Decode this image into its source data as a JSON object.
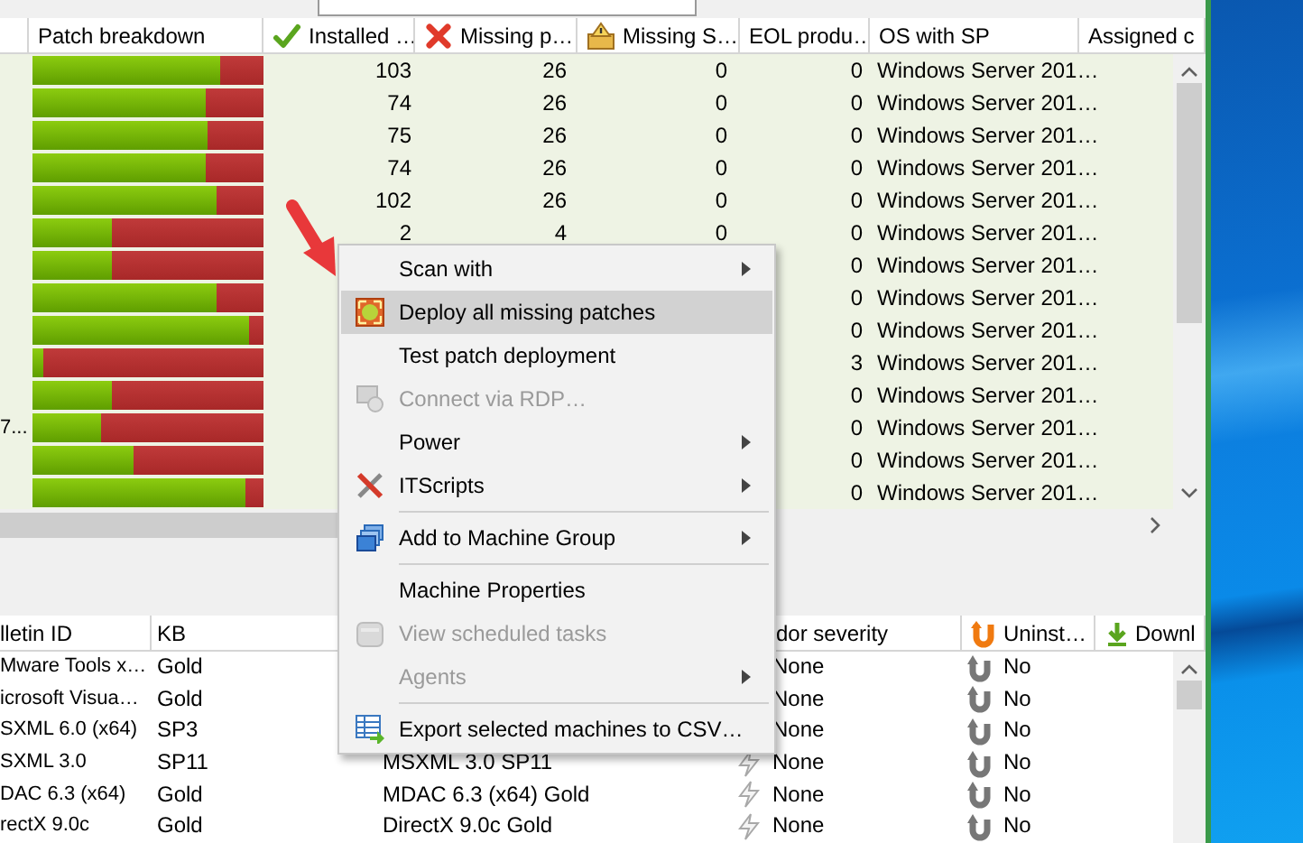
{
  "upper_table": {
    "columns": [
      {
        "label": "Patch breakdown",
        "kind": "bar"
      },
      {
        "label": "Installed …",
        "kind": "check"
      },
      {
        "label": "Missing p…",
        "kind": "cross"
      },
      {
        "label": "Missing S…",
        "kind": "warning"
      },
      {
        "label": "EOL produ…",
        "kind": "number"
      },
      {
        "label": "OS with SP",
        "kind": "text"
      },
      {
        "label": "Assigned c",
        "kind": "text"
      }
    ],
    "rows": [
      {
        "level": 0.81,
        "installed": "103",
        "missing": "26",
        "missing_s": "0",
        "eol": "0",
        "os": "Windows Server 201…"
      },
      {
        "level": 0.75,
        "installed": "74",
        "missing": "26",
        "missing_s": "0",
        "eol": "0",
        "os": "Windows Server 201…"
      },
      {
        "level": 0.76,
        "installed": "75",
        "missing": "26",
        "missing_s": "0",
        "eol": "0",
        "os": "Windows Server 201…"
      },
      {
        "level": 0.75,
        "installed": "74",
        "missing": "26",
        "missing_s": "0",
        "eol": "0",
        "os": "Windows Server 201…"
      },
      {
        "level": 0.8,
        "installed": "102",
        "missing": "26",
        "missing_s": "0",
        "eol": "0",
        "os": "Windows Server 201…"
      },
      {
        "level": 0.34,
        "installed": "2",
        "missing": "4",
        "missing_s": "0",
        "eol": "0",
        "os": "Windows Server 201…"
      },
      {
        "level": 0.34,
        "eol": "0",
        "os": "Windows Server 201…"
      },
      {
        "level": 0.8,
        "eol": "0",
        "os": "Windows Server 201…"
      },
      {
        "level": 0.94,
        "eol": "0",
        "os": "Windows Server 201…"
      },
      {
        "level": 0.05,
        "eol": "3",
        "os": "Windows Server 201…"
      },
      {
        "level": 0.34,
        "eol": "0",
        "os": "Windows Server 201…"
      },
      {
        "column_1": "7...",
        "level": 0.3,
        "eol": "0",
        "os": "Windows Server 201…"
      },
      {
        "level": 0.44,
        "eol": "0",
        "os": "Windows Server 201…"
      },
      {
        "level": 0.92,
        "eol": "0",
        "os": "Windows Server 201…"
      }
    ]
  },
  "lower_table": {
    "columns": [
      {
        "label": "lletin ID",
        "kind": "text"
      },
      {
        "label": "KB",
        "kind": "text"
      },
      {
        "label": "dor severity",
        "kind": "text"
      },
      {
        "label": "Uninst…",
        "kind": "uninstall"
      },
      {
        "label": "Downl",
        "kind": "download"
      }
    ],
    "rows": [
      {
        "bulletin": "Mware Tools x…",
        "kb": "Gold",
        "severity": "None",
        "uninstall": "No"
      },
      {
        "bulletin": "icrosoft Visua…",
        "kb": "Gold",
        "severity": "None",
        "uninstall": "No"
      },
      {
        "bulletin": "SXML 6.0 (x64)",
        "kb": "SP3",
        "severity": "None",
        "uninstall": "No"
      },
      {
        "bulletin": "SXML 3.0",
        "kb": "SP11",
        "product": "MSXML 3.0 SP11",
        "severity": "None",
        "uninstall": "No"
      },
      {
        "bulletin": "DAC 6.3 (x64)",
        "kb": "Gold",
        "product": "MDAC 6.3 (x64) Gold",
        "severity": "None",
        "uninstall": "No"
      },
      {
        "bulletin": "rectX 9.0c",
        "kb": "Gold",
        "product": "DirectX 9.0c Gold",
        "severity": "None",
        "uninstall": "No"
      }
    ]
  },
  "context_menu": {
    "items": [
      {
        "kind": "text",
        "label": "Scan with",
        "submenu": true,
        "selected": false,
        "disabled": false
      },
      {
        "kind": "deploy",
        "label": "Deploy all missing patches",
        "submenu": false,
        "selected": true,
        "disabled": false
      },
      {
        "kind": "text",
        "label": "Test patch deployment",
        "submenu": false,
        "selected": false,
        "disabled": false
      },
      {
        "kind": "rdp",
        "label": "Connect via RDP…",
        "submenu": false,
        "selected": false,
        "disabled": true
      },
      {
        "kind": "text",
        "label": "Power",
        "submenu": true,
        "selected": false,
        "disabled": false
      },
      {
        "kind": "scripts",
        "label": "ITScripts",
        "submenu": true,
        "selected": false,
        "disabled": false
      },
      {
        "kind": "separator"
      },
      {
        "kind": "group",
        "label": "Add to Machine Group",
        "submenu": true,
        "selected": false,
        "disabled": false
      },
      {
        "kind": "separator"
      },
      {
        "kind": "text",
        "label": "Machine Properties",
        "submenu": false,
        "selected": false,
        "disabled": false
      },
      {
        "kind": "tasks",
        "label": "View scheduled tasks",
        "submenu": false,
        "selected": false,
        "disabled": true
      },
      {
        "kind": "text",
        "label": "Agents",
        "submenu": true,
        "selected": false,
        "disabled": true
      },
      {
        "kind": "separator"
      },
      {
        "kind": "export",
        "label": "Export selected machines to CSV…",
        "submenu": false,
        "selected": false,
        "disabled": false
      }
    ]
  }
}
